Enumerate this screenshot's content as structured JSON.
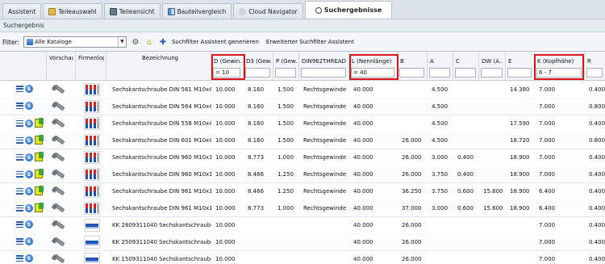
{
  "tabs": [
    {
      "label": "Assistent",
      "icon": "none",
      "active": false
    },
    {
      "label": "Teileauswahl",
      "icon": "folder-icon",
      "active": false
    },
    {
      "label": "Teileansicht",
      "icon": "part-view-icon",
      "active": false
    },
    {
      "label": "Bauteilvergleich",
      "icon": "compare-icon",
      "active": false
    },
    {
      "label": "Cloud Navigator",
      "icon": "cloud-icon",
      "active": false
    },
    {
      "label": "Suchergebnisse",
      "icon": "search-icon",
      "active": true
    }
  ],
  "section_title": "Suchergebnis",
  "toolbar": {
    "filter_label": "Filter:",
    "catalog_value": "Alle Kataloge",
    "generate_label": "Suchfilter Assistent generieren",
    "extended_label": "Erweiterter Suchfilter Assistent"
  },
  "columns": [
    {
      "key": "actions",
      "label": ""
    },
    {
      "key": "preview",
      "label": "Vorschau"
    },
    {
      "key": "logo",
      "label": "Firmenlogo"
    },
    {
      "key": "name",
      "label": "Bezeichnung"
    },
    {
      "key": "D",
      "label": "D (Gewin...",
      "filter": "= 10",
      "highlighted": true
    },
    {
      "key": "D3",
      "label": "D3 (Gew...",
      "filter": ""
    },
    {
      "key": "P",
      "label": "P (Gew...",
      "filter": ""
    },
    {
      "key": "thread",
      "label": "DIN962THREAD ...",
      "filter": ""
    },
    {
      "key": "L",
      "label": "L (Nennlänge)",
      "filter": "= 40",
      "highlighted": true
    },
    {
      "key": "B",
      "label": "B",
      "filter": ""
    },
    {
      "key": "A",
      "label": "A",
      "filter": ""
    },
    {
      "key": "C",
      "label": "C",
      "filter": ""
    },
    {
      "key": "DW",
      "label": "DW (Ä...",
      "filter": ""
    },
    {
      "key": "E",
      "label": "E",
      "filter": ""
    },
    {
      "key": "K",
      "label": "K (Kopfhöhe)",
      "filter": "6 - 7",
      "highlighted": true
    },
    {
      "key": "R",
      "label": "R",
      "filter": ""
    }
  ],
  "rows": [
    {
      "icon": "blue",
      "logo": "din",
      "name": "Sechskantschraube DIN 561 M10x40",
      "D": "10.000",
      "D3": "8.160",
      "P": "1.500",
      "thread": "Rechtsgewinde",
      "L": "40.000",
      "B": "",
      "A": "4.500",
      "C": "",
      "DW": "",
      "E": "14.380",
      "K": "7.000",
      "R": "0.400"
    },
    {
      "icon": "blue",
      "logo": "din",
      "name": "Sechskantschraube DIN 564 M10x40",
      "D": "10.000",
      "D3": "8.160",
      "P": "1.500",
      "thread": "Rechtsgewinde",
      "L": "40.000",
      "B": "",
      "A": "4.500",
      "C": "",
      "DW": "",
      "E": "",
      "K": "7.000",
      "R": "0.800"
    },
    {
      "icon": "ok",
      "logo": "din",
      "name": "Sechskantschraube DIN 558 M10x40",
      "D": "10.000",
      "D3": "8.160",
      "P": "1.500",
      "thread": "Rechtsgewinde",
      "L": "40.000",
      "B": "",
      "A": "4.500",
      "C": "",
      "DW": "",
      "E": "17.590",
      "K": "7.000",
      "R": "0.400"
    },
    {
      "icon": "ok",
      "logo": "din",
      "name": "Sechskantschraube DIN 601 M10x40",
      "D": "10.000",
      "D3": "8.160",
      "P": "1.500",
      "thread": "Rechtsgewinde",
      "L": "40.000",
      "B": "26.000",
      "A": "4.500",
      "C": "",
      "DW": "",
      "E": "18.720",
      "K": "7.000",
      "R": "0.800"
    },
    {
      "icon": "ok",
      "logo": "din",
      "name": "Sechskantschraube DIN 960 M10x1x40",
      "D": "10.000",
      "D3": "8.773",
      "P": "1.000",
      "thread": "Rechtsgewinde",
      "L": "40.000",
      "B": "26.000",
      "A": "3.000",
      "C": "0.400",
      "DW": "",
      "E": "18.900",
      "K": "7.000",
      "R": "0.400"
    },
    {
      "icon": "ok",
      "logo": "din",
      "name": "Sechskantschraube DIN 960 M10x1.2...",
      "D": "10.000",
      "D3": "8.466",
      "P": "1.250",
      "thread": "Rechtsgewinde",
      "L": "40.000",
      "B": "26.000",
      "A": "3.750",
      "C": "0.400",
      "DW": "",
      "E": "18.900",
      "K": "7.000",
      "R": "0.400"
    },
    {
      "icon": "ok",
      "logo": "din",
      "name": "Sechskantschraube DIN 961 M10x1.2...",
      "D": "10.000",
      "D3": "8.466",
      "P": "1.250",
      "thread": "Rechtsgewinde",
      "L": "40.000",
      "B": "36.250",
      "A": "3.750",
      "C": "0.600",
      "DW": "15.600",
      "E": "18.900",
      "K": "6.400",
      "R": "0.400"
    },
    {
      "icon": "ok",
      "logo": "din",
      "name": "Sechskantschraube DIN 961 M10x1x40",
      "D": "10.000",
      "D3": "8.773",
      "P": "1.000",
      "thread": "Rechtsgewinde",
      "L": "40.000",
      "B": "37.000",
      "A": "3.000",
      "C": "0.600",
      "DW": "15.600",
      "E": "18.900",
      "K": "6.400",
      "R": "0.400"
    },
    {
      "icon": "blue",
      "logo": "kk",
      "name": "KK 2809311040 Sechskantschraube ...",
      "D": "10.000",
      "D3": "",
      "P": "",
      "thread": "",
      "L": "40.000",
      "B": "26.000",
      "A": "",
      "C": "",
      "DW": "",
      "E": "",
      "K": "7.000",
      "R": "0.400"
    },
    {
      "icon": "blue",
      "logo": "kk",
      "name": "KK 2509311040 Sechskantschraube ...",
      "D": "10.000",
      "D3": "",
      "P": "",
      "thread": "",
      "L": "40.000",
      "B": "26.000",
      "A": "",
      "C": "",
      "DW": "",
      "E": "",
      "K": "7.000",
      "R": "0.400"
    },
    {
      "icon": "blue",
      "logo": "kk",
      "name": "KK 1509311040 Sechskantschraube ...",
      "D": "10.000",
      "D3": "",
      "P": "",
      "thread": "",
      "L": "40.000",
      "B": "26.000",
      "A": "",
      "C": "",
      "DW": "",
      "E": "",
      "K": "7.000",
      "R": "0.400"
    }
  ],
  "colors": {
    "highlight": "#d9141b",
    "accent": "#1b5fb5"
  }
}
